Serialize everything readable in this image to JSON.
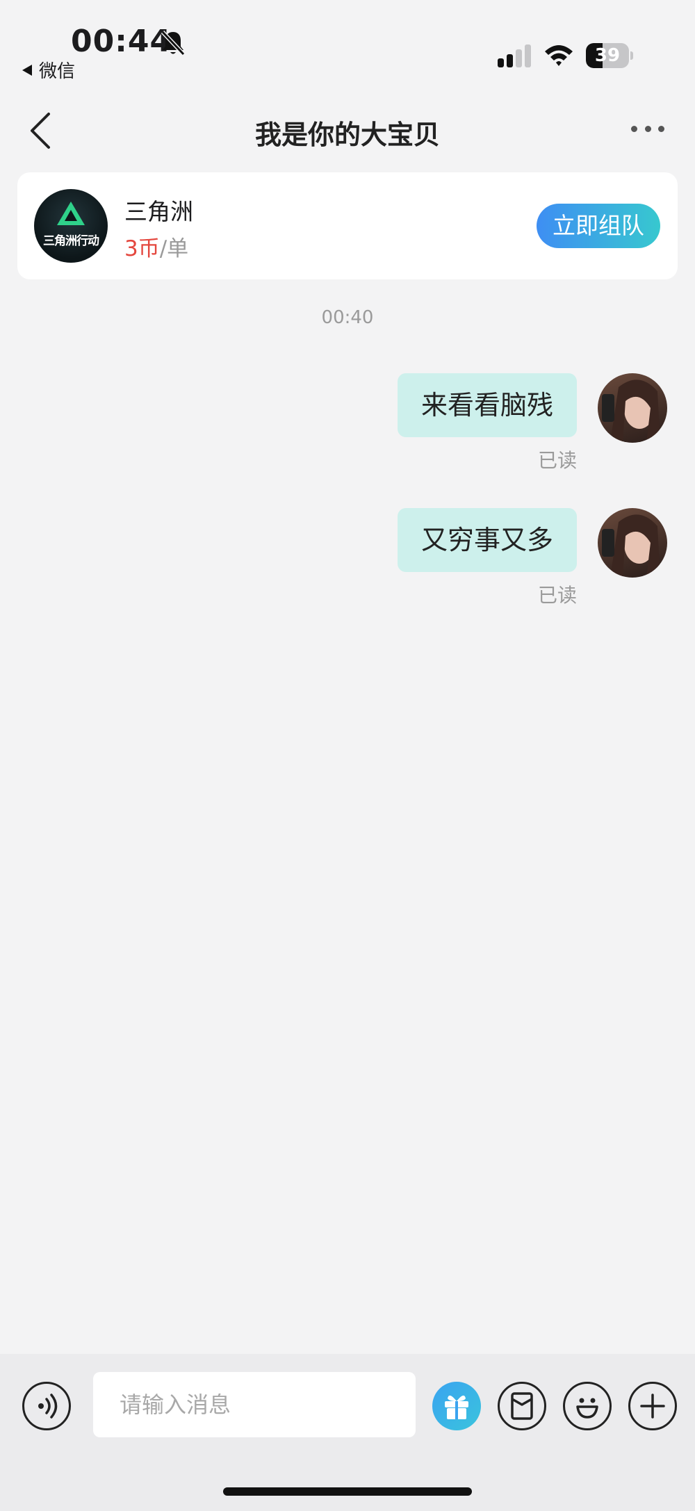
{
  "status_bar": {
    "time": "00:44",
    "back_app_label": "微信",
    "battery_level": "39",
    "battery_fraction": 0.39,
    "icons": [
      "bell-slash-icon",
      "signal-icon",
      "wifi-icon",
      "battery-icon"
    ]
  },
  "nav": {
    "title": "我是你的大宝贝",
    "icons": [
      "chevron-left-icon",
      "more-icon"
    ]
  },
  "game_card": {
    "logo_text": "三角洲行动",
    "name": "三角洲",
    "price_value": "3币",
    "price_unit": "/单",
    "action_label": "立即组队"
  },
  "chat": {
    "time_divider": "00:40",
    "messages": [
      {
        "text": "来看看脑残",
        "status": "已读"
      },
      {
        "text": "又穷事又多",
        "status": "已读"
      }
    ]
  },
  "input_bar": {
    "placeholder": "请输入消息",
    "icons": [
      "voice-icon",
      "gift-icon",
      "red-packet-icon",
      "emoji-icon",
      "plus-icon"
    ]
  },
  "colors": {
    "accent_start": "#3e8ef3",
    "accent_end": "#37c8cf",
    "bubble": "#cdf0ec",
    "price_red": "#e4473e",
    "background": "#f3f3f4"
  }
}
